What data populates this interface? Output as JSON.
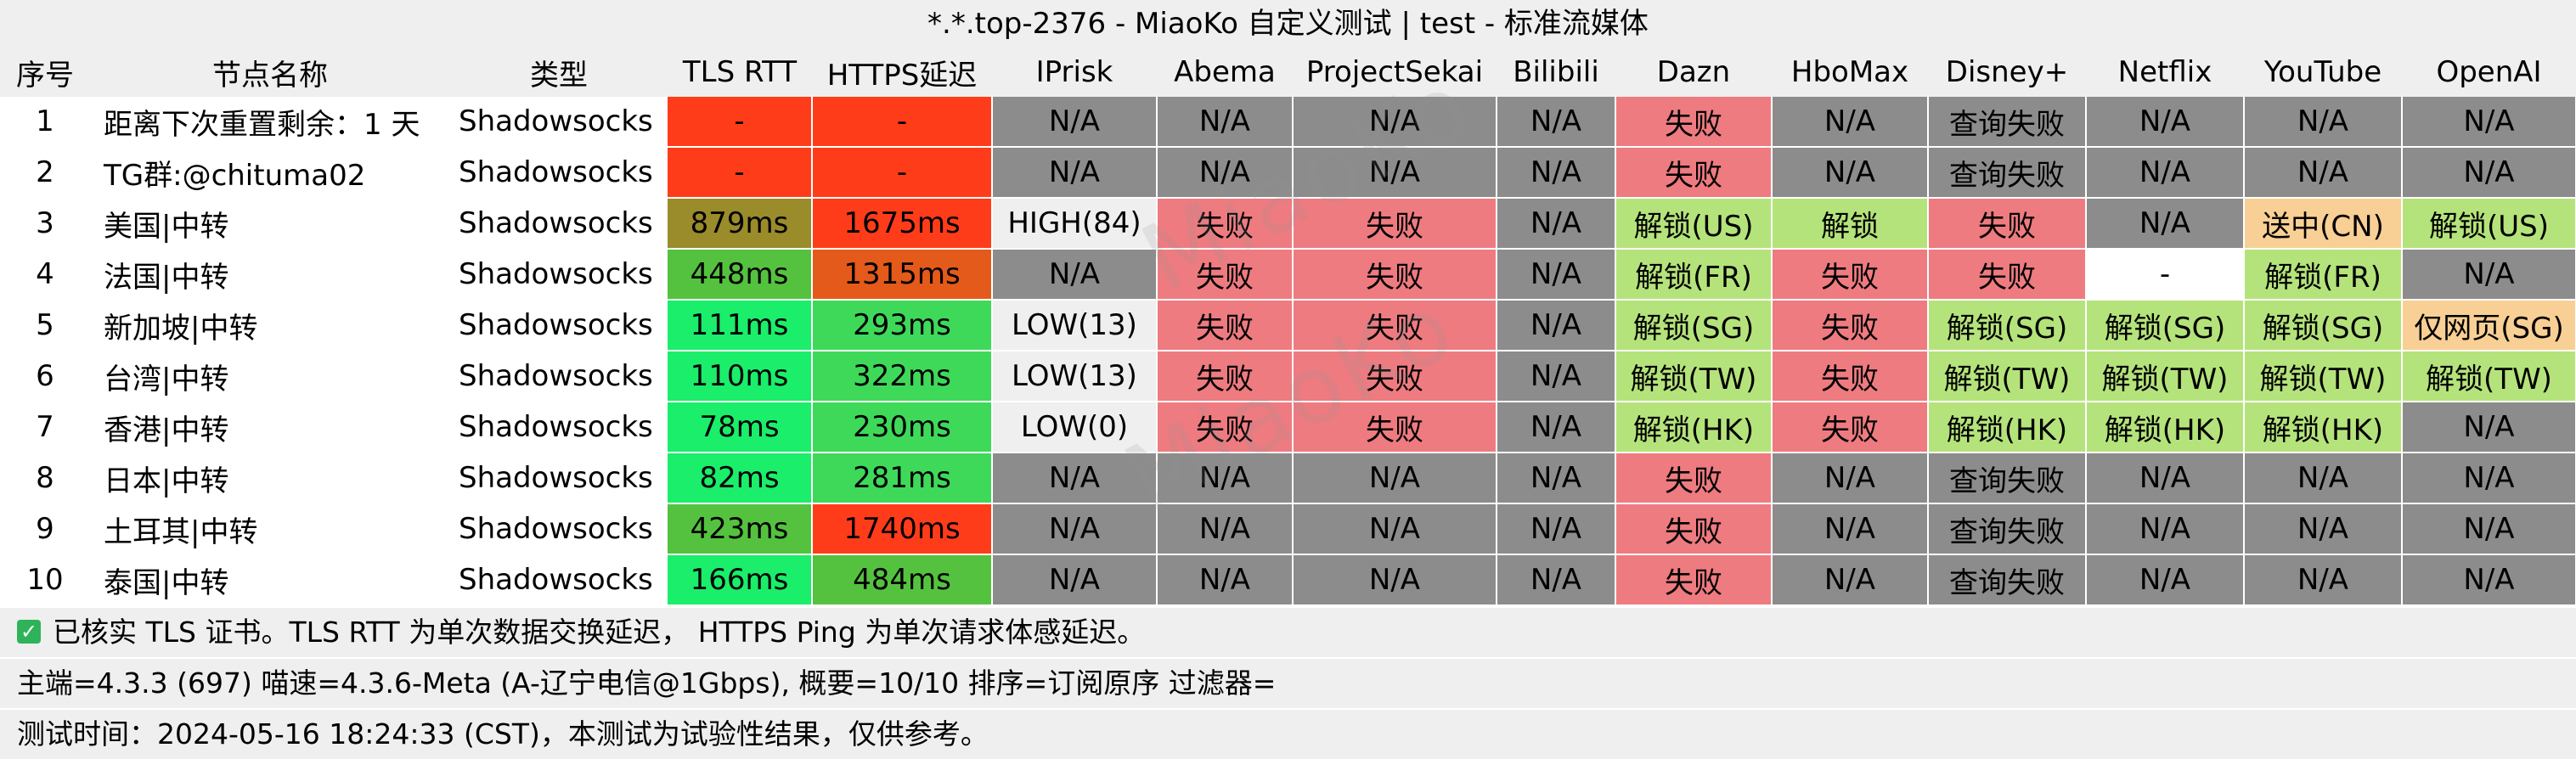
{
  "title": "*.*.top-2376 - MiaoKo 自定义测试 | test - 标准流媒体",
  "watermark": "MiaoKo",
  "headers": [
    "序号",
    "节点名称",
    "类型",
    "TLS RTT",
    "HTTPS延迟",
    "IPrisk",
    "Abema",
    "ProjectSekai",
    "Bilibili",
    "Dazn",
    "HboMax",
    "Disney+",
    "Netflix",
    "YouTube",
    "OpenAI"
  ],
  "colors": {
    "na": "#8c8c8c",
    "fail": "#ee7b80",
    "unlock": "#b5e37b",
    "query_fail": "#8c8c8c",
    "pending": "#f8cf95",
    "white": "#ffffff",
    "iprisk_light": "#efefef",
    "latency_red": "#ff3c1a",
    "latency_olive": "#9a8b2b",
    "latency_orange": "#e45a1a",
    "latency_green_bright": "#1aee6a",
    "latency_green": "#3fd95a",
    "latency_green_mid": "#55c23f"
  },
  "rows": [
    {
      "idx": "1",
      "name": "距离下次重置剩余：1 天",
      "type": "Shadowsocks",
      "cells": [
        [
          "-",
          "latency_red"
        ],
        [
          "-",
          "latency_red"
        ],
        [
          "N/A",
          "na"
        ],
        [
          "N/A",
          "na"
        ],
        [
          "N/A",
          "na"
        ],
        [
          "N/A",
          "na"
        ],
        [
          "失败",
          "fail"
        ],
        [
          "N/A",
          "na"
        ],
        [
          "查询失败",
          "query_fail"
        ],
        [
          "N/A",
          "na"
        ],
        [
          "N/A",
          "na"
        ],
        [
          "N/A",
          "na"
        ]
      ]
    },
    {
      "idx": "2",
      "name": "TG群:@chituma02",
      "type": "Shadowsocks",
      "cells": [
        [
          "-",
          "latency_red"
        ],
        [
          "-",
          "latency_red"
        ],
        [
          "N/A",
          "na"
        ],
        [
          "N/A",
          "na"
        ],
        [
          "N/A",
          "na"
        ],
        [
          "N/A",
          "na"
        ],
        [
          "失败",
          "fail"
        ],
        [
          "N/A",
          "na"
        ],
        [
          "查询失败",
          "query_fail"
        ],
        [
          "N/A",
          "na"
        ],
        [
          "N/A",
          "na"
        ],
        [
          "N/A",
          "na"
        ]
      ]
    },
    {
      "idx": "3",
      "name": "美国|中转",
      "type": "Shadowsocks",
      "cells": [
        [
          "879ms",
          "latency_olive"
        ],
        [
          "1675ms",
          "latency_red"
        ],
        [
          "HIGH(84)",
          "iprisk_light"
        ],
        [
          "失败",
          "fail"
        ],
        [
          "失败",
          "fail"
        ],
        [
          "N/A",
          "na"
        ],
        [
          "解锁(US)",
          "unlock"
        ],
        [
          "解锁",
          "unlock"
        ],
        [
          "失败",
          "fail"
        ],
        [
          "N/A",
          "na"
        ],
        [
          "送中(CN)",
          "pending"
        ],
        [
          "解锁(US)",
          "unlock"
        ]
      ]
    },
    {
      "idx": "4",
      "name": "法国|中转",
      "type": "Shadowsocks",
      "cells": [
        [
          "448ms",
          "latency_green_mid"
        ],
        [
          "1315ms",
          "latency_orange"
        ],
        [
          "N/A",
          "na"
        ],
        [
          "失败",
          "fail"
        ],
        [
          "失败",
          "fail"
        ],
        [
          "N/A",
          "na"
        ],
        [
          "解锁(FR)",
          "unlock"
        ],
        [
          "失败",
          "fail"
        ],
        [
          "失败",
          "fail"
        ],
        [
          "-",
          "white"
        ],
        [
          "解锁(FR)",
          "unlock"
        ],
        [
          "N/A",
          "na"
        ]
      ]
    },
    {
      "idx": "5",
      "name": "新加坡|中转",
      "type": "Shadowsocks",
      "cells": [
        [
          "111ms",
          "latency_green_bright"
        ],
        [
          "293ms",
          "latency_green"
        ],
        [
          "LOW(13)",
          "iprisk_light"
        ],
        [
          "失败",
          "fail"
        ],
        [
          "失败",
          "fail"
        ],
        [
          "N/A",
          "na"
        ],
        [
          "解锁(SG)",
          "unlock"
        ],
        [
          "失败",
          "fail"
        ],
        [
          "解锁(SG)",
          "unlock"
        ],
        [
          "解锁(SG)",
          "unlock"
        ],
        [
          "解锁(SG)",
          "unlock"
        ],
        [
          "仅网页(SG)",
          "pending"
        ]
      ]
    },
    {
      "idx": "6",
      "name": "台湾|中转",
      "type": "Shadowsocks",
      "cells": [
        [
          "110ms",
          "latency_green_bright"
        ],
        [
          "322ms",
          "latency_green"
        ],
        [
          "LOW(13)",
          "iprisk_light"
        ],
        [
          "失败",
          "fail"
        ],
        [
          "失败",
          "fail"
        ],
        [
          "N/A",
          "na"
        ],
        [
          "解锁(TW)",
          "unlock"
        ],
        [
          "失败",
          "fail"
        ],
        [
          "解锁(TW)",
          "unlock"
        ],
        [
          "解锁(TW)",
          "unlock"
        ],
        [
          "解锁(TW)",
          "unlock"
        ],
        [
          "解锁(TW)",
          "unlock"
        ]
      ]
    },
    {
      "idx": "7",
      "name": "香港|中转",
      "type": "Shadowsocks",
      "cells": [
        [
          "78ms",
          "latency_green_bright"
        ],
        [
          "230ms",
          "latency_green"
        ],
        [
          "LOW(0)",
          "iprisk_light"
        ],
        [
          "失败",
          "fail"
        ],
        [
          "失败",
          "fail"
        ],
        [
          "N/A",
          "na"
        ],
        [
          "解锁(HK)",
          "unlock"
        ],
        [
          "失败",
          "fail"
        ],
        [
          "解锁(HK)",
          "unlock"
        ],
        [
          "解锁(HK)",
          "unlock"
        ],
        [
          "解锁(HK)",
          "unlock"
        ],
        [
          "N/A",
          "na"
        ]
      ]
    },
    {
      "idx": "8",
      "name": "日本|中转",
      "type": "Shadowsocks",
      "cells": [
        [
          "82ms",
          "latency_green_bright"
        ],
        [
          "281ms",
          "latency_green"
        ],
        [
          "N/A",
          "na"
        ],
        [
          "N/A",
          "na"
        ],
        [
          "N/A",
          "na"
        ],
        [
          "N/A",
          "na"
        ],
        [
          "失败",
          "fail"
        ],
        [
          "N/A",
          "na"
        ],
        [
          "查询失败",
          "query_fail"
        ],
        [
          "N/A",
          "na"
        ],
        [
          "N/A",
          "na"
        ],
        [
          "N/A",
          "na"
        ]
      ]
    },
    {
      "idx": "9",
      "name": "土耳其|中转",
      "type": "Shadowsocks",
      "cells": [
        [
          "423ms",
          "latency_green_mid"
        ],
        [
          "1740ms",
          "latency_red"
        ],
        [
          "N/A",
          "na"
        ],
        [
          "N/A",
          "na"
        ],
        [
          "N/A",
          "na"
        ],
        [
          "N/A",
          "na"
        ],
        [
          "失败",
          "fail"
        ],
        [
          "N/A",
          "na"
        ],
        [
          "查询失败",
          "query_fail"
        ],
        [
          "N/A",
          "na"
        ],
        [
          "N/A",
          "na"
        ],
        [
          "N/A",
          "na"
        ]
      ]
    },
    {
      "idx": "10",
      "name": "泰国|中转",
      "type": "Shadowsocks",
      "cells": [
        [
          "166ms",
          "latency_green_bright"
        ],
        [
          "484ms",
          "latency_green_mid"
        ],
        [
          "N/A",
          "na"
        ],
        [
          "N/A",
          "na"
        ],
        [
          "N/A",
          "na"
        ],
        [
          "N/A",
          "na"
        ],
        [
          "失败",
          "fail"
        ],
        [
          "N/A",
          "na"
        ],
        [
          "查询失败",
          "query_fail"
        ],
        [
          "N/A",
          "na"
        ],
        [
          "N/A",
          "na"
        ],
        [
          "N/A",
          "na"
        ]
      ]
    }
  ],
  "footer": {
    "check_icon": "checkbox-checked-icon",
    "line1": "已核实 TLS 证书。TLS RTT 为单次数据交换延迟， HTTPS Ping 为单次请求体感延迟。",
    "line2": "主端=4.3.3 (697) 喵速=4.3.6-Meta (A-辽宁电信@1Gbps), 概要=10/10 排序=订阅原序 过滤器=",
    "line3": "测试时间：2024-05-16 18:24:33 (CST)，本测试为试验性结果，仅供参考。"
  }
}
